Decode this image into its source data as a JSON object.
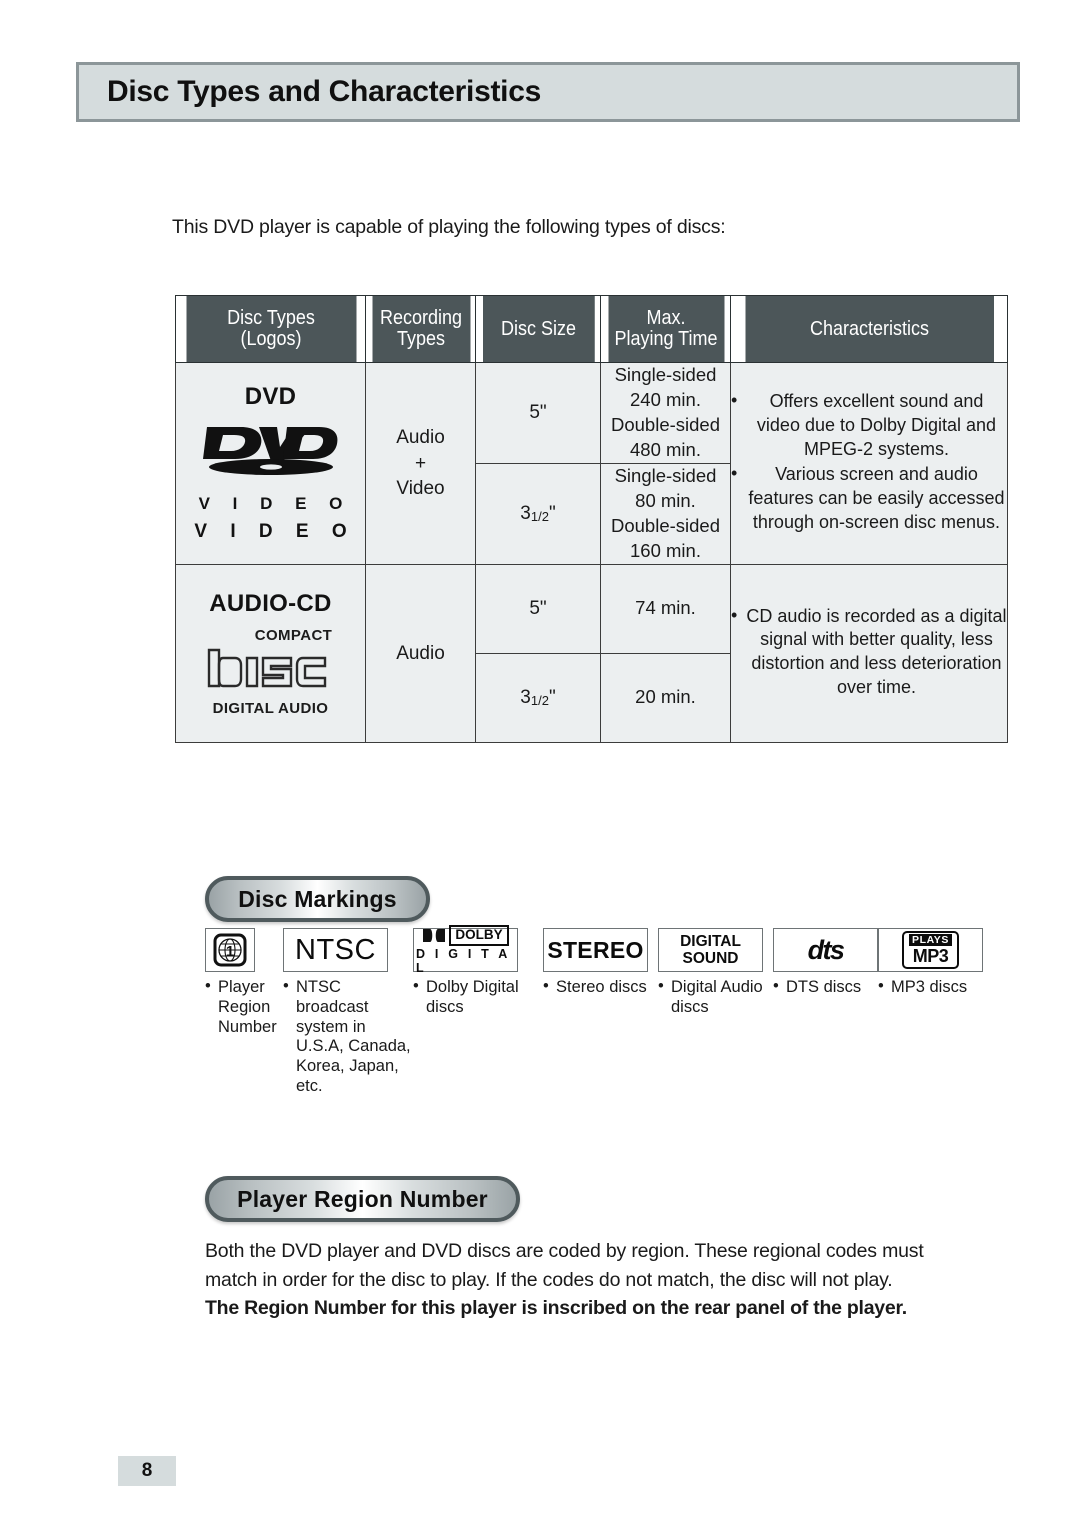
{
  "page": {
    "title": "Disc Types and Characteristics",
    "number": "8",
    "intro": "This DVD player is capable of playing the following types of discs:"
  },
  "table": {
    "headers": [
      {
        "line1": "Disc Types",
        "line2": "(Logos)"
      },
      {
        "line1": "Recording",
        "line2": "Types"
      },
      {
        "line1": "Disc Size",
        "line2": ""
      },
      {
        "line1": "Max.",
        "line2": "Playing Time"
      },
      {
        "line1": "Characteristics",
        "line2": ""
      }
    ],
    "rows": [
      {
        "type_name": "DVD",
        "logo": "dvd-video-logo",
        "logo_text_1": "V I D E O",
        "logo_text_2": "V I D E O",
        "recording_type": "Audio\n+\nVideo",
        "sizes": [
          {
            "size": "5",
            "unit": "\"",
            "fraction": "",
            "time": "Single-sided\n240 min.\nDouble-sided\n480 min."
          },
          {
            "size": "3",
            "unit": "\"",
            "fraction": "1/2",
            "time": "Single-sided\n80 min.\nDouble-sided\n160 min."
          }
        ],
        "characteristics": [
          "Offers excellent sound and video due to Dolby Digital and MPEG-2 systems.",
          "Various screen and audio features can be easily accessed through on-screen disc menus."
        ]
      },
      {
        "type_name": "AUDIO-CD",
        "logo": "compact-disc-digital-audio-logo",
        "logo_text_1": "COMPACT",
        "logo_text_2": "DIGITAL AUDIO",
        "recording_type": "Audio",
        "sizes": [
          {
            "size": "5",
            "unit": "\"",
            "fraction": "",
            "time": "74 min."
          },
          {
            "size": "3",
            "unit": "\"",
            "fraction": "1/2",
            "time": "20 min."
          }
        ],
        "characteristics": [
          "CD audio is recorded as a digital signal with better quality, less distortion and less deterioration over time."
        ]
      }
    ]
  },
  "disc_markings": {
    "heading": "Disc Markings",
    "items": [
      {
        "icon": "region-globe-icon",
        "badge_text": "1",
        "caption": "Player Region Number"
      },
      {
        "icon": "ntsc-icon",
        "badge_text": "NTSC",
        "caption": "NTSC broadcast system in U.S.A, Canada, Korea, Japan, etc."
      },
      {
        "icon": "dolby-digital-icon",
        "badge_text": "DOLBY",
        "badge_text_2": "D I G I T A L",
        "caption": "Dolby Digital discs"
      },
      {
        "icon": "stereo-icon",
        "badge_text": "STEREO",
        "caption": "Stereo discs"
      },
      {
        "icon": "digital-sound-icon",
        "badge_text": "DIGITAL",
        "badge_text_2": "SOUND",
        "caption": "Digital Audio discs"
      },
      {
        "icon": "dts-icon",
        "badge_text": "dts",
        "caption": "DTS discs"
      },
      {
        "icon": "plays-mp3-icon",
        "badge_text": "PLAYS",
        "badge_text_2": "MP3",
        "caption": "MP3 discs"
      }
    ]
  },
  "region_number": {
    "heading": "Player Region Number",
    "paragraph_1": "Both the DVD player and DVD discs are coded by region. These regional codes must",
    "paragraph_2": "match in order for the disc to play. If the codes do not match, the disc will not play.",
    "paragraph_3": "The Region Number for this player is inscribed on the rear panel of the player."
  },
  "colors": {
    "banner_bg": "#d5dcdd",
    "banner_border": "#8c9699",
    "table_header_bg": "#4c5659",
    "table_cell_bg": "#eceff0",
    "pill_border": "#4f5a5d"
  }
}
